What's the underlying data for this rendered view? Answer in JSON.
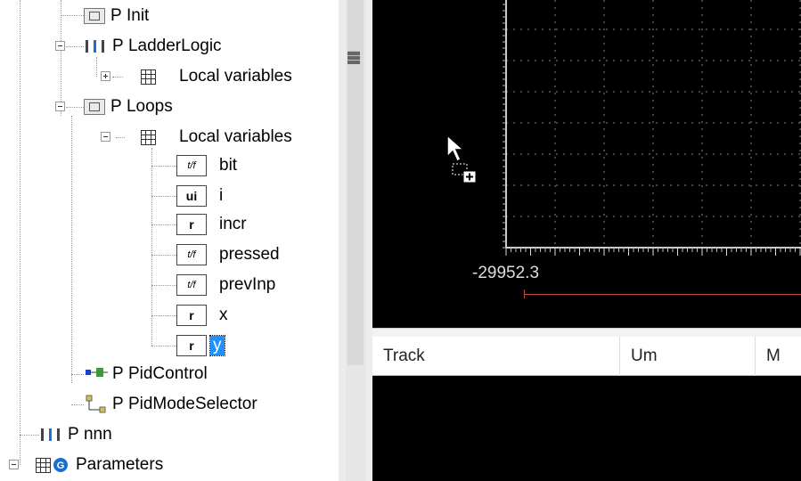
{
  "tree": {
    "items": [
      {
        "label": "Init",
        "prefix": "P"
      },
      {
        "label": "LadderLogic",
        "prefix": "P"
      },
      {
        "label": "Local variables"
      },
      {
        "label": "Loops",
        "prefix": "P"
      },
      {
        "label": "Local variables"
      },
      {
        "label": "bit",
        "type": "t/f"
      },
      {
        "label": "i",
        "type": "ui"
      },
      {
        "label": "incr",
        "type": "r"
      },
      {
        "label": "pressed",
        "type": "t/f"
      },
      {
        "label": "prevInp",
        "type": "t/f"
      },
      {
        "label": "x",
        "type": "r"
      },
      {
        "label": "y",
        "type": "r"
      },
      {
        "label": "PidControl",
        "prefix": "P"
      },
      {
        "label": "PidModeSelector",
        "prefix": "P"
      },
      {
        "label": "nnn",
        "prefix": "P"
      },
      {
        "label": "Parameters"
      }
    ]
  },
  "chart": {
    "axis_min_label": "-29952.3"
  },
  "table": {
    "columns": [
      "Track",
      "Um",
      "M"
    ]
  },
  "colors": {
    "selection": "#1e90ff",
    "chart_bg": "#000000",
    "trace": "#c05040"
  }
}
